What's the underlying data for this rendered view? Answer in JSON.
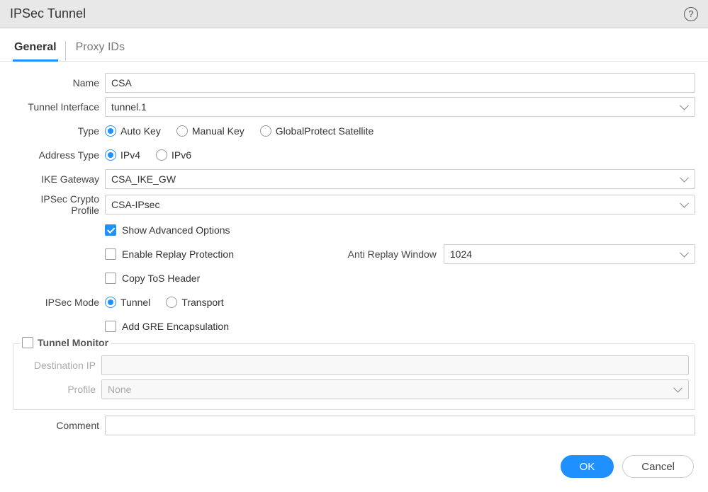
{
  "title": "IPSec Tunnel",
  "tabs": {
    "general": "General",
    "proxy": "Proxy IDs"
  },
  "labels": {
    "name": "Name",
    "tunnel_interface": "Tunnel Interface",
    "type": "Type",
    "address_type": "Address Type",
    "ike_gateway": "IKE Gateway",
    "ipsec_crypto": "IPSec Crypto Profile",
    "ipsec_mode": "IPSec Mode",
    "anti_replay": "Anti Replay Window",
    "destination_ip": "Destination IP",
    "profile": "Profile",
    "comment": "Comment"
  },
  "values": {
    "name": "CSA",
    "tunnel_interface": "tunnel.1",
    "ike_gateway": "CSA_IKE_GW",
    "ipsec_crypto": "CSA-IPsec",
    "anti_replay": "1024",
    "profile": "None",
    "destination_ip": "",
    "comment": ""
  },
  "radios": {
    "type": {
      "auto": "Auto Key",
      "manual": "Manual Key",
      "gp": "GlobalProtect Satellite"
    },
    "address": {
      "v4": "IPv4",
      "v6": "IPv6"
    },
    "mode": {
      "tunnel": "Tunnel",
      "transport": "Transport"
    }
  },
  "checks": {
    "show_advanced": "Show Advanced Options",
    "enable_replay": "Enable Replay Protection",
    "copy_tos": "Copy ToS Header",
    "add_gre": "Add GRE Encapsulation",
    "tunnel_monitor": "Tunnel Monitor"
  },
  "buttons": {
    "ok": "OK",
    "cancel": "Cancel"
  }
}
